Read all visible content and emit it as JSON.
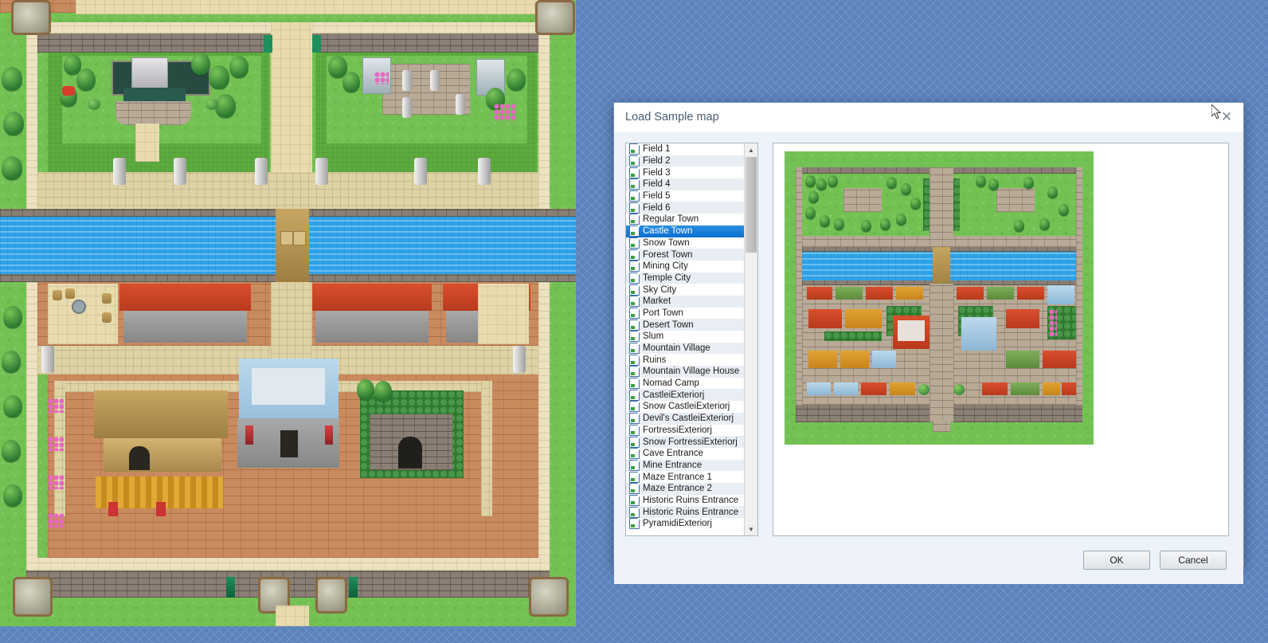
{
  "dialog": {
    "title": "Load Sample map",
    "close_icon": "close-icon",
    "ok_label": "OK",
    "cancel_label": "Cancel",
    "scroll_up_icon": "chevron-up-icon",
    "scroll_down_icon": "chevron-down-icon"
  },
  "list": {
    "selected": "Castle Town",
    "items": [
      "Field 1",
      "Field 2",
      "Field 3",
      "Field 4",
      "Field 5",
      "Field 6",
      "Regular Town",
      "Castle Town",
      "Snow Town",
      "Forest Town",
      "Mining City",
      "Temple City",
      "Sky City",
      "Market",
      "Port Town",
      "Desert Town",
      "Slum",
      "Mountain Village",
      "Ruins",
      "Mountain Village House",
      "Nomad Camp",
      "CastleiExteriorj",
      "Snow CastleiExteriorj",
      "Devil's CastleiExteriorj",
      "FortressiExteriorj",
      "Snow FortressiExteriorj",
      "Cave Entrance",
      "Mine Entrance",
      "Maze Entrance 1",
      "Maze Entrance 2",
      "Historic Ruins Entrance",
      "Historic Ruins Entrance",
      "PyramidiExteriorj"
    ]
  },
  "preview": {
    "name": "map-preview"
  },
  "colors": {
    "desktop_background": "#5b82bd",
    "dialog_background": "#eef3f9",
    "titlebar_background": "#ffffff",
    "selection_blue": "#0b6fd0",
    "list_background": "#ffffff",
    "list_alt_row": "#e9eef4",
    "grass": "#74c153",
    "water": "#2ea2e8",
    "roof_red": "#d94f2d",
    "roof_orange": "#e2a332",
    "roof_blue": "#bcd9ec",
    "roof_green": "#7fae5a",
    "stone": "#b8aa96",
    "sand": "#e8dcae"
  },
  "editor": {
    "map_name": "map-canvas"
  }
}
